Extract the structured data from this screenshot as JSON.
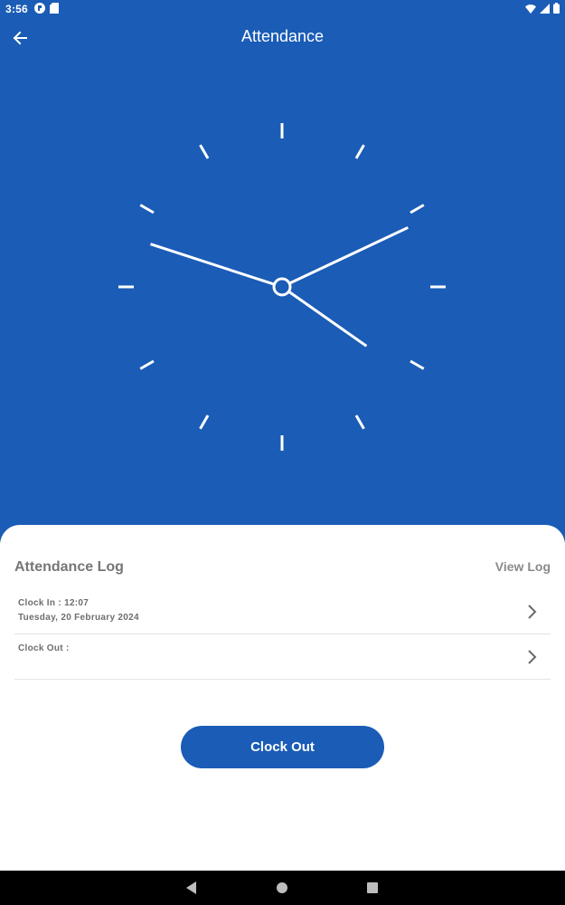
{
  "status_bar": {
    "time": "3:56",
    "left_icons": [
      "app-notification-icon",
      "sd-card-icon"
    ],
    "right_icons": [
      "wifi-icon",
      "signal-icon",
      "battery-icon"
    ]
  },
  "app_bar": {
    "title": "Attendance",
    "back_icon": "arrow-left-icon"
  },
  "clock": {
    "hour": 4,
    "minute": 10,
    "second": 48
  },
  "attendance_log": {
    "title": "Attendance Log",
    "view_log_label": "View Log",
    "rows": [
      {
        "line1": "Clock In : 12:07",
        "line2": "Tuesday, 20 February 2024"
      },
      {
        "line1": "Clock Out :",
        "line2": ""
      }
    ]
  },
  "clock_out_button": {
    "label": "Clock Out"
  },
  "nav_bar": {
    "buttons": [
      "back-triangle-icon",
      "home-circle-icon",
      "recents-square-icon"
    ]
  },
  "colors": {
    "primary": "#1a5cb6",
    "sheet": "#ffffff",
    "muted_text": "#767676"
  }
}
